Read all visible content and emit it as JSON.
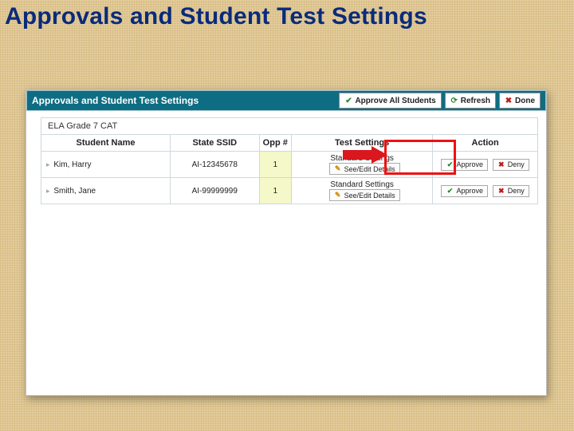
{
  "slide": {
    "title": "Approvals and Student Test Settings"
  },
  "dialog": {
    "title": "Approvals and Student Test Settings",
    "approve_all": "Approve All Students",
    "refresh": "Refresh",
    "done": "Done"
  },
  "test": {
    "name": "ELA Grade 7 CAT"
  },
  "columns": {
    "name": "Student Name",
    "ssid": "State SSID",
    "opp": "Opp #",
    "settings": "Test Settings",
    "action": "Action"
  },
  "buttons": {
    "see_edit": "See/Edit Details",
    "approve": "Approve",
    "deny": "Deny"
  },
  "students": [
    {
      "name": "Kim, Harry",
      "ssid": "AI-12345678",
      "opp": "1",
      "settings": "Standard Settings"
    },
    {
      "name": "Smith, Jane",
      "ssid": "AI-99999999",
      "opp": "1",
      "settings": "Standard Settings"
    }
  ]
}
